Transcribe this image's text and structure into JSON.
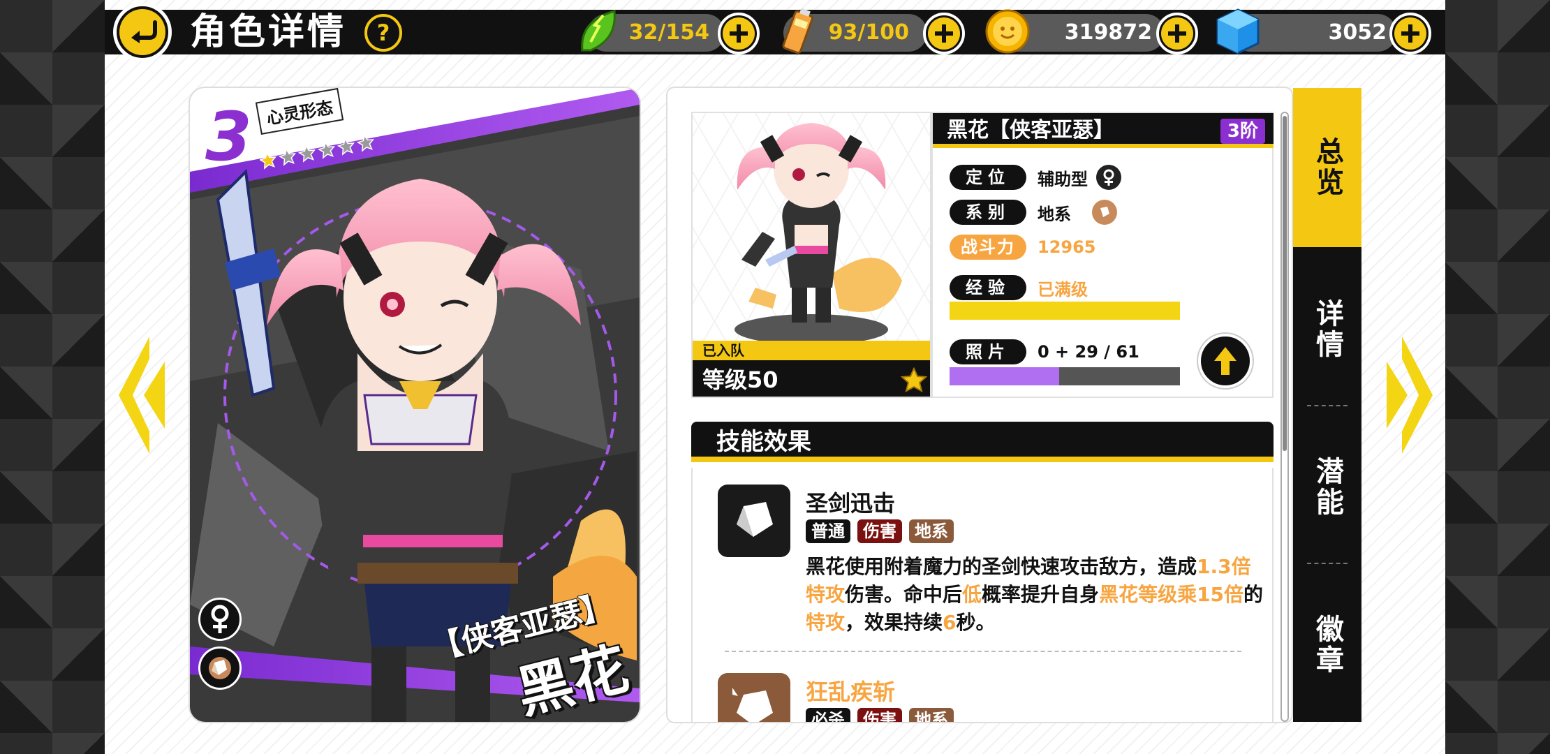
{
  "header": {
    "title": "角色详情",
    "help_label": "?"
  },
  "resources": {
    "stamina": {
      "value": "32/154",
      "color": "#f4c713"
    },
    "energy": {
      "value": "93/100",
      "color": "#f4c713"
    },
    "gold": {
      "value": "319872",
      "color": "#ffffff"
    },
    "crystal": {
      "value": "3052",
      "color": "#ffffff"
    }
  },
  "card": {
    "rank": "3",
    "form_label": "心灵形态",
    "stars_filled": 1,
    "stars_total": 6,
    "subtitle": "【侠客亚瑟】",
    "name": "黑花"
  },
  "portrait": {
    "joined_label": "已入队",
    "level_label": "等级50"
  },
  "info": {
    "title": "黑花【侠客亚瑟】",
    "tier": "3阶",
    "role_label": "定位",
    "role_value": "辅助型",
    "element_label": "系别",
    "element_value": "地系",
    "power_label": "战斗力",
    "power_value": "12965",
    "exp_label": "经验",
    "exp_value": "已满级",
    "exp_progress": 1.0,
    "photo_label": "照片",
    "photo_value": "0 + 29 / 61",
    "photo_progress": 0.475
  },
  "skills": {
    "header": "技能效果",
    "items": [
      {
        "name": "圣剑迅击",
        "tags": [
          "普通",
          "伤害",
          "地系"
        ],
        "desc_parts": [
          {
            "t": "黑花使用附着魔力的圣剑快速攻击敌方，造成",
            "h": false
          },
          {
            "t": "1.3倍特攻",
            "h": true
          },
          {
            "t": "伤害。命中后",
            "h": false
          },
          {
            "t": "低",
            "h": true
          },
          {
            "t": "概率提升自身",
            "h": false
          },
          {
            "t": "黑花等级乘15倍",
            "h": true
          },
          {
            "t": "的",
            "h": false
          },
          {
            "t": "特攻",
            "h": true
          },
          {
            "t": "，效果持续",
            "h": false
          },
          {
            "t": "6",
            "h": true
          },
          {
            "t": "秒。",
            "h": false
          }
        ]
      },
      {
        "name": "狂乱疾斩",
        "tags": [
          "必杀",
          "伤害",
          "地系"
        ]
      }
    ]
  },
  "tabs": [
    {
      "label": "总览",
      "active": true
    },
    {
      "label": "详情",
      "active": false
    },
    {
      "label": "潜能",
      "active": false
    },
    {
      "label": "徽章",
      "active": false
    }
  ],
  "colors": {
    "accent_yellow": "#f4c713",
    "accent_orange": "#f7a541",
    "accent_purple": "#8b2fd0",
    "exp_bar": "#f4d513",
    "photo_bar": "#b06ef0"
  }
}
